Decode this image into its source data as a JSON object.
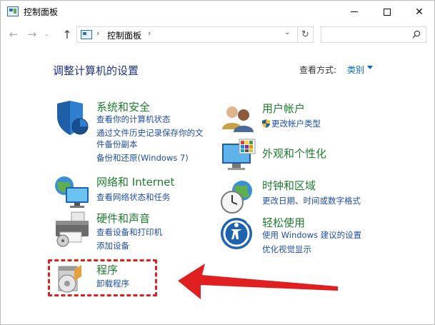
{
  "window": {
    "title": "控制面板",
    "minimize_label": "",
    "maximize_label": "",
    "close_label": "✕"
  },
  "nav": {
    "back": "←",
    "forward": "→",
    "recent": "⌄",
    "up": "↑",
    "address_separator": "›",
    "address_path": "控制面板",
    "address_dropdown": "⌄",
    "refresh": "↻",
    "search_placeholder": ""
  },
  "header": {
    "title": "调整计算机的设置",
    "view_by_label": "查看方式:",
    "view_by_value": "类别"
  },
  "categories": [
    {
      "id": "system-security",
      "title": "系统和安全",
      "links": [
        "查看你的计算机状态",
        "通过文件历史记录保存你的文",
        "件备份副本",
        "备份和还原(Windows 7)"
      ]
    },
    {
      "id": "network-internet",
      "title": "网络和 Internet",
      "links": [
        "查看网络状态和任务"
      ]
    },
    {
      "id": "hardware-sound",
      "title": "硬件和声音",
      "links": [
        "查看设备和打印机",
        "添加设备"
      ]
    },
    {
      "id": "programs",
      "title": "程序",
      "links": [
        "卸载程序"
      ]
    },
    {
      "id": "user-accounts",
      "title": "用户帐户",
      "links": [
        "更改帐户类型"
      ]
    },
    {
      "id": "appearance",
      "title": "外观和个性化",
      "links": []
    },
    {
      "id": "clock-region",
      "title": "时钟和区域",
      "links": [
        "更改日期、时间或数字格式"
      ]
    },
    {
      "id": "ease-of-access",
      "title": "轻松使用",
      "links": [
        "使用 Windows 建议的设置",
        "优化视觉显示"
      ]
    }
  ],
  "colors": {
    "heading": "#1e3287",
    "category_title": "#1e7d2e",
    "link": "#1f4ea8",
    "annotation": "#e02020"
  }
}
